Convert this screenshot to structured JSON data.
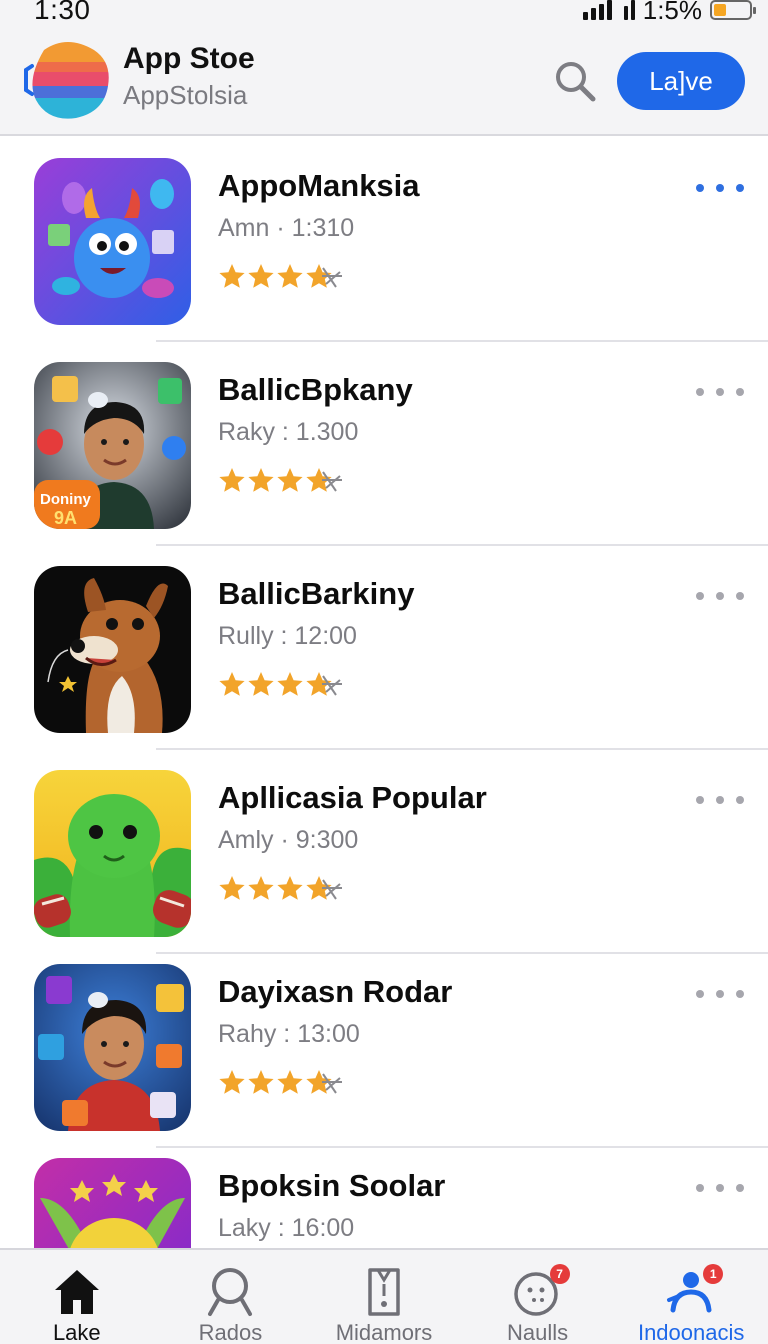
{
  "status_bar": {
    "time": "1:30",
    "battery_percent": "1:5%"
  },
  "header": {
    "title": "App Stoe",
    "subtitle": "AppStolsia",
    "search_icon": "magnifier-icon",
    "primary_button_label": "La]ve"
  },
  "apps": [
    {
      "name": "AppoManksia",
      "meta": "Amn · 1:310",
      "rating": 4.5,
      "icon": "blue-monster-icon"
    },
    {
      "name": "BallicBpkany",
      "meta": "Raky : 1.300",
      "rating": 4.5,
      "icon": "boy-portrait-icon",
      "icon_text": [
        "Doniny",
        "9А"
      ]
    },
    {
      "name": "BallicBarkiny",
      "meta": "Rully : 12:00",
      "rating": 4.5,
      "icon": "fox-dog-icon"
    },
    {
      "name": "Apllicasia Popular",
      "meta": "Amly · 9:300",
      "rating": 4.5,
      "icon": "green-creature-icon"
    },
    {
      "name": "Dayixasn Rodar",
      "meta": "Rahy : 13:00",
      "rating": 4.5,
      "icon": "boy-portrait-red-icon"
    },
    {
      "name": "Bpoksin Soolar",
      "meta": "Laky : 16:00",
      "rating": null,
      "icon": "yellow-creature-icon"
    }
  ],
  "tabs": [
    {
      "label": "Lake",
      "icon": "home-icon",
      "state": "selected-dark"
    },
    {
      "label": "Rados",
      "icon": "search-icon",
      "state": ""
    },
    {
      "label": "Midamors",
      "icon": "app-device-icon",
      "state": ""
    },
    {
      "label": "Naulls",
      "icon": "face-icon",
      "state": "",
      "badge": "7"
    },
    {
      "label": "Indoonacis",
      "icon": "user-icon",
      "state": "selected-blue",
      "badge": "1"
    }
  ],
  "colors": {
    "accent": "#1f68e8",
    "star": "#f2a42a",
    "badge": "#e53b3b"
  }
}
